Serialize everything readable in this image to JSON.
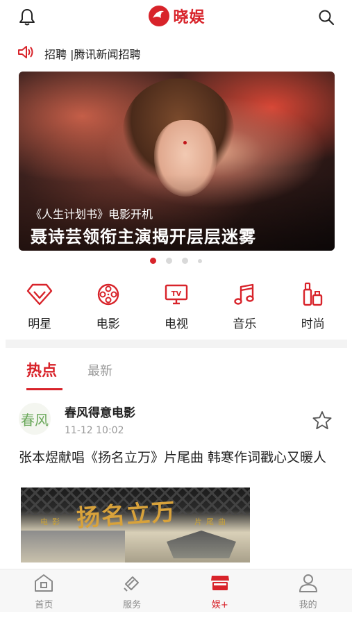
{
  "app": {
    "logo_text": "晓娱",
    "brand_color": "#d8232a"
  },
  "header": {
    "left_icon": "bell-icon",
    "right_icon": "search-icon"
  },
  "notice": {
    "icon": "speaker-icon",
    "text": "招聘 |腾讯新闻招聘"
  },
  "banner": {
    "subtitle": "《人生计划书》电影开机",
    "title": "聂诗芸领衔主演揭开层层迷雾",
    "page_indicator": {
      "count": 4,
      "active": 1
    }
  },
  "categories": [
    {
      "label": "明星",
      "icon": "diamond-icon"
    },
    {
      "label": "电影",
      "icon": "film-reel-icon"
    },
    {
      "label": "电视",
      "icon": "tv-icon"
    },
    {
      "label": "音乐",
      "icon": "music-note-icon"
    },
    {
      "label": "时尚",
      "icon": "perfume-icon"
    }
  ],
  "feed_tabs": {
    "hot": "热点",
    "latest": "最新",
    "active": "热点"
  },
  "post": {
    "author": "春风得意电影",
    "avatar_text": "春风",
    "time": "11-12 10:02",
    "title": "张本煜献唱《扬名立万》片尾曲 韩寒作词戳心又暖人",
    "image_left_text": "电影",
    "image_right_text": "片尾曲",
    "image_calligraphy": "扬名立万"
  },
  "tabbar": [
    {
      "label": "首页",
      "icon": "home-icon"
    },
    {
      "label": "服务",
      "icon": "service-icon"
    },
    {
      "label": "娱+",
      "icon": "store-icon",
      "active": true
    },
    {
      "label": "我的",
      "icon": "user-icon"
    }
  ]
}
